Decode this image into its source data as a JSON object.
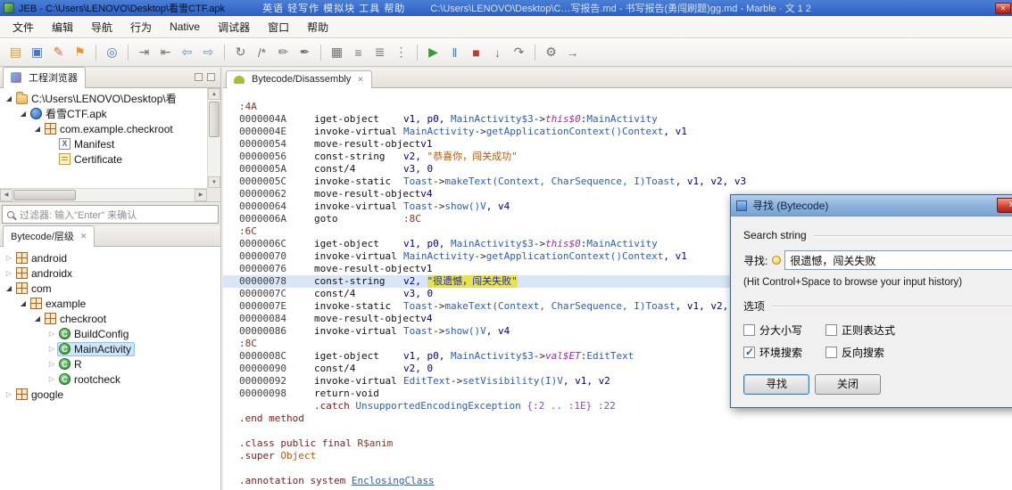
{
  "colors": {
    "titlebar_blue": "#2c5fc4",
    "accent_blue": "#2a5db8",
    "selection_blue": "#cde6f9",
    "row_highlight": "#d9e6f8",
    "string_orange": "#c25400",
    "search_highlight": "#e6e44e",
    "keyword_red": "#7a1a1a"
  },
  "ui": {
    "tab_close_glyph": "✕",
    "up_glyph": "▲",
    "down_glyph": "▼",
    "left_glyph": "◀",
    "right_glyph": "▶",
    "twisty_open": "◢",
    "twisty_closed": "▷"
  },
  "title_bar": {
    "app_title": "JEB - C:\\Users\\LENOVO\\Desktop\\看雪CTF.apk",
    "background_menu": "英语  轻写作  模拟块  工具  帮助",
    "background_title": "C:\\Users\\LENOVO\\Desktop\\C…写报告.md - 书写报告(勇闯刷题)gg.md - Marble · 文 1 2",
    "close_glyph": "✕"
  },
  "menu_bar": {
    "items": [
      "文件",
      "编辑",
      "导航",
      "行为",
      "Native",
      "调试器",
      "窗口",
      "帮助"
    ]
  },
  "toolbar": {
    "items": [
      {
        "name": "open-project-icon",
        "glyph": "▤",
        "color": "#d79b3a"
      },
      {
        "name": "save-icon",
        "glyph": "▣",
        "color": "#4a78c0"
      },
      {
        "name": "edit-script-icon",
        "glyph": "✎",
        "color": "#d0703a"
      },
      {
        "name": "breakpoint-flag-icon",
        "glyph": "⚑",
        "color": "#e09a30"
      },
      {
        "sep": true
      },
      {
        "name": "browser-icon",
        "glyph": "◎",
        "color": "#4a78c0"
      },
      {
        "sep": true
      },
      {
        "name": "jump-into-icon",
        "glyph": "⇥",
        "color": "#707070"
      },
      {
        "name": "jump-out-icon",
        "glyph": "⇤",
        "color": "#707070"
      },
      {
        "name": "nav-back-icon",
        "glyph": "⇦",
        "color": "#5b8fd0"
      },
      {
        "name": "nav-forward-icon",
        "glyph": "⇨",
        "color": "#5b8fd0"
      },
      {
        "sep": true
      },
      {
        "name": "decompile-icon",
        "glyph": "↻",
        "color": "#707070"
      },
      {
        "name": "comment-icon",
        "glyph": "/*",
        "color": "#707070"
      },
      {
        "name": "rename-icon",
        "glyph": "✏",
        "color": "#707070"
      },
      {
        "name": "edit-document-icon",
        "glyph": "✒",
        "color": "#707070"
      },
      {
        "sep": true
      },
      {
        "name": "table-view-icon",
        "glyph": "▦",
        "color": "#707070"
      },
      {
        "name": "tree-view-icon",
        "glyph": "≡",
        "color": "#707070"
      },
      {
        "name": "hierarchy-view-icon",
        "glyph": "≣",
        "color": "#707070"
      },
      {
        "name": "sequence-view-icon",
        "glyph": "⋮",
        "color": "#707070"
      },
      {
        "sep": true
      },
      {
        "name": "debug-start-icon",
        "glyph": "▶",
        "color": "#3a9a3a"
      },
      {
        "name": "debug-pause-icon",
        "glyph": "‖",
        "color": "#4a78c0"
      },
      {
        "name": "debug-stop-icon",
        "glyph": "■",
        "color": "#b04030"
      },
      {
        "name": "step-into-icon",
        "glyph": "↓",
        "color": "#707070"
      },
      {
        "name": "step-over-icon",
        "glyph": "↷",
        "color": "#707070"
      },
      {
        "sep": true
      },
      {
        "name": "settings-gear-icon",
        "glyph": "⚙",
        "color": "#707070"
      },
      {
        "name": "detach-icon",
        "glyph": "→",
        "color": "#707070"
      }
    ]
  },
  "project_panel": {
    "tab_label": "工程浏览器",
    "filter_placeholder": "过滤器: 输入\"Enter\" 来确认",
    "tree": [
      {
        "depth": 0,
        "exp": "open",
        "icon": "folder",
        "label": "C:\\Users\\LENOVO\\Desktop\\看"
      },
      {
        "depth": 1,
        "exp": "open",
        "icon": "apk",
        "label": "看雪CTF.apk"
      },
      {
        "depth": 2,
        "exp": "open",
        "icon": "package",
        "label": "com.example.checkroot"
      },
      {
        "depth": 3,
        "exp": null,
        "icon": "xml",
        "label": "Manifest"
      },
      {
        "depth": 3,
        "exp": null,
        "icon": "cert",
        "label": "Certificate"
      }
    ]
  },
  "hierarchy_panel": {
    "tab_label": "Bytecode/层级",
    "tree": [
      {
        "depth": 0,
        "exp": "closed",
        "icon": "package",
        "label": "android"
      },
      {
        "depth": 0,
        "exp": "closed",
        "icon": "package",
        "label": "androidx"
      },
      {
        "depth": 0,
        "exp": "open",
        "icon": "package",
        "label": "com"
      },
      {
        "depth": 1,
        "exp": "open",
        "icon": "package",
        "label": "example"
      },
      {
        "depth": 2,
        "exp": "open",
        "icon": "package",
        "label": "checkroot"
      },
      {
        "depth": 3,
        "exp": "closed",
        "icon": "class",
        "label": "BuildConfig"
      },
      {
        "depth": 3,
        "exp": "closed",
        "icon": "class",
        "label": "MainActivity",
        "selected": true
      },
      {
        "depth": 3,
        "exp": "closed",
        "icon": "class",
        "label": "R"
      },
      {
        "depth": 3,
        "exp": "closed",
        "icon": "class",
        "label": "rootcheck"
      },
      {
        "depth": 0,
        "exp": "closed",
        "icon": "package",
        "label": "google"
      }
    ]
  },
  "main_panel": {
    "tab_label": "Bytecode/Disassembly",
    "code": [
      {
        "type": "label",
        "text": ":4A"
      },
      {
        "type": "ins",
        "addr": "0000004A",
        "mn": "iget-object",
        "ops": [
          [
            "reg",
            "v1, p0, "
          ],
          [
            "type",
            "MainActivity$3"
          ],
          [
            "plain",
            "->"
          ],
          [
            "fld",
            "this$0"
          ],
          [
            "plain",
            ":"
          ],
          [
            "type",
            "MainActivity"
          ]
        ]
      },
      {
        "type": "ins",
        "addr": "0000004E",
        "mn": "invoke-virtual",
        "ops": [
          [
            "type",
            "MainActivity"
          ],
          [
            "plain",
            "->"
          ],
          [
            "type",
            "getApplicationContext()Context"
          ],
          [
            "reg",
            ", v1"
          ]
        ]
      },
      {
        "type": "ins",
        "addr": "00000054",
        "mn": "move-result-object",
        "ops": [
          [
            "reg",
            "v1"
          ]
        ]
      },
      {
        "type": "ins",
        "addr": "00000056",
        "mn": "const-string",
        "ops": [
          [
            "reg",
            "v2, "
          ],
          [
            "str",
            "\"恭喜你，闯关成功\""
          ]
        ]
      },
      {
        "type": "ins",
        "addr": "0000005A",
        "mn": "const/4",
        "ops": [
          [
            "reg",
            "v3, 0"
          ]
        ]
      },
      {
        "type": "ins",
        "addr": "0000005C",
        "mn": "invoke-static",
        "ops": [
          [
            "type",
            "Toast"
          ],
          [
            "plain",
            "->"
          ],
          [
            "type",
            "makeText(Context, CharSequence, I)Toast"
          ],
          [
            "reg",
            ", v1, v2, v3"
          ]
        ]
      },
      {
        "type": "ins",
        "addr": "00000062",
        "mn": "move-result-object",
        "ops": [
          [
            "reg",
            "v4"
          ]
        ]
      },
      {
        "type": "ins",
        "addr": "00000064",
        "mn": "invoke-virtual",
        "ops": [
          [
            "type",
            "Toast"
          ],
          [
            "plain",
            "->"
          ],
          [
            "type",
            "show()V"
          ],
          [
            "reg",
            ", v4"
          ]
        ]
      },
      {
        "type": "ins",
        "addr": "0000006A",
        "mn": "goto",
        "ops": [
          [
            "lbl",
            ":8C"
          ]
        ]
      },
      {
        "type": "label",
        "text": ":6C"
      },
      {
        "type": "ins",
        "addr": "0000006C",
        "mn": "iget-object",
        "ops": [
          [
            "reg",
            "v1, p0, "
          ],
          [
            "type",
            "MainActivity$3"
          ],
          [
            "plain",
            "->"
          ],
          [
            "fld",
            "this$0"
          ],
          [
            "plain",
            ":"
          ],
          [
            "type",
            "MainActivity"
          ]
        ]
      },
      {
        "type": "ins",
        "addr": "00000070",
        "mn": "invoke-virtual",
        "ops": [
          [
            "type",
            "MainActivity"
          ],
          [
            "plain",
            "->"
          ],
          [
            "type",
            "getApplicationContext()Context"
          ],
          [
            "reg",
            ", v1"
          ]
        ]
      },
      {
        "type": "ins",
        "addr": "00000076",
        "mn": "move-result-object",
        "ops": [
          [
            "reg",
            "v1"
          ]
        ]
      },
      {
        "type": "ins",
        "addr": "00000078",
        "mn": "const-string",
        "hl": true,
        "ops": [
          [
            "reg",
            "v2, "
          ],
          [
            "strhl",
            "\"很遗憾，闯关失败\""
          ]
        ]
      },
      {
        "type": "ins",
        "addr": "0000007C",
        "mn": "const/4",
        "ops": [
          [
            "reg",
            "v3, 0"
          ]
        ]
      },
      {
        "type": "ins",
        "addr": "0000007E",
        "mn": "invoke-static",
        "ops": [
          [
            "type",
            "Toast"
          ],
          [
            "plain",
            "->"
          ],
          [
            "type",
            "makeText(Context, CharSequence, I)Toast"
          ],
          [
            "reg",
            ", v1, v2, v3"
          ]
        ]
      },
      {
        "type": "ins",
        "addr": "00000084",
        "mn": "move-result-object",
        "ops": [
          [
            "reg",
            "v4"
          ]
        ]
      },
      {
        "type": "ins",
        "addr": "00000086",
        "mn": "invoke-virtual",
        "ops": [
          [
            "type",
            "Toast"
          ],
          [
            "plain",
            "->"
          ],
          [
            "type",
            "show()V"
          ],
          [
            "reg",
            ", v4"
          ]
        ]
      },
      {
        "type": "label",
        "text": ":8C"
      },
      {
        "type": "ins",
        "addr": "0000008C",
        "mn": "iget-object",
        "ops": [
          [
            "reg",
            "v1, p0, "
          ],
          [
            "type",
            "MainActivity$3"
          ],
          [
            "plain",
            "->"
          ],
          [
            "fld",
            "val$ET"
          ],
          [
            "plain",
            ":"
          ],
          [
            "type",
            "EditText"
          ]
        ]
      },
      {
        "type": "ins",
        "addr": "00000090",
        "mn": "const/4",
        "ops": [
          [
            "reg",
            "v2, 0"
          ]
        ]
      },
      {
        "type": "ins",
        "addr": "00000092",
        "mn": "invoke-virtual",
        "ops": [
          [
            "type",
            "EditText"
          ],
          [
            "plain",
            "->"
          ],
          [
            "type",
            "setVisibility(I)V"
          ],
          [
            "reg",
            ", v1, v2"
          ]
        ]
      },
      {
        "type": "ins",
        "addr": "00000098",
        "mn": "return-void",
        "ops": []
      },
      {
        "type": "raw",
        "indent": 84,
        "parts": [
          [
            "kw",
            ".catch "
          ],
          [
            "exc",
            "UnsupportedEncodingException "
          ],
          [
            "rng",
            "{:2 .. :1E} :22"
          ]
        ]
      },
      {
        "type": "raw",
        "parts": [
          [
            "kw",
            ".end method"
          ]
        ]
      },
      {
        "type": "blank"
      },
      {
        "type": "raw",
        "parts": [
          [
            "kw",
            ".class public final "
          ],
          [
            "lbl",
            "R$anim"
          ]
        ]
      },
      {
        "type": "raw",
        "parts": [
          [
            "kw",
            ".super "
          ],
          [
            "obj",
            "Object"
          ]
        ]
      },
      {
        "type": "blank"
      },
      {
        "type": "raw",
        "parts": [
          [
            "kw",
            ".annotation system "
          ],
          [
            "link",
            "EnclosingClass"
          ]
        ]
      }
    ]
  },
  "find_dialog": {
    "title": "寻找 (Bytecode)",
    "close_glyph": "✕",
    "search_group_label": "Search string",
    "find_label": "寻找:",
    "find_value": "很遗憾，闯关失败",
    "history_hint": "(Hit Control+Space to browse your input history)",
    "options_group_label": "选项",
    "checkboxes": [
      {
        "label": "分大小写",
        "checked": false
      },
      {
        "label": "正则表达式",
        "checked": false
      },
      {
        "label": "环境搜索",
        "checked": true
      },
      {
        "label": "反向搜索",
        "checked": false
      }
    ],
    "find_button": "寻找",
    "close_button": "关闭"
  }
}
